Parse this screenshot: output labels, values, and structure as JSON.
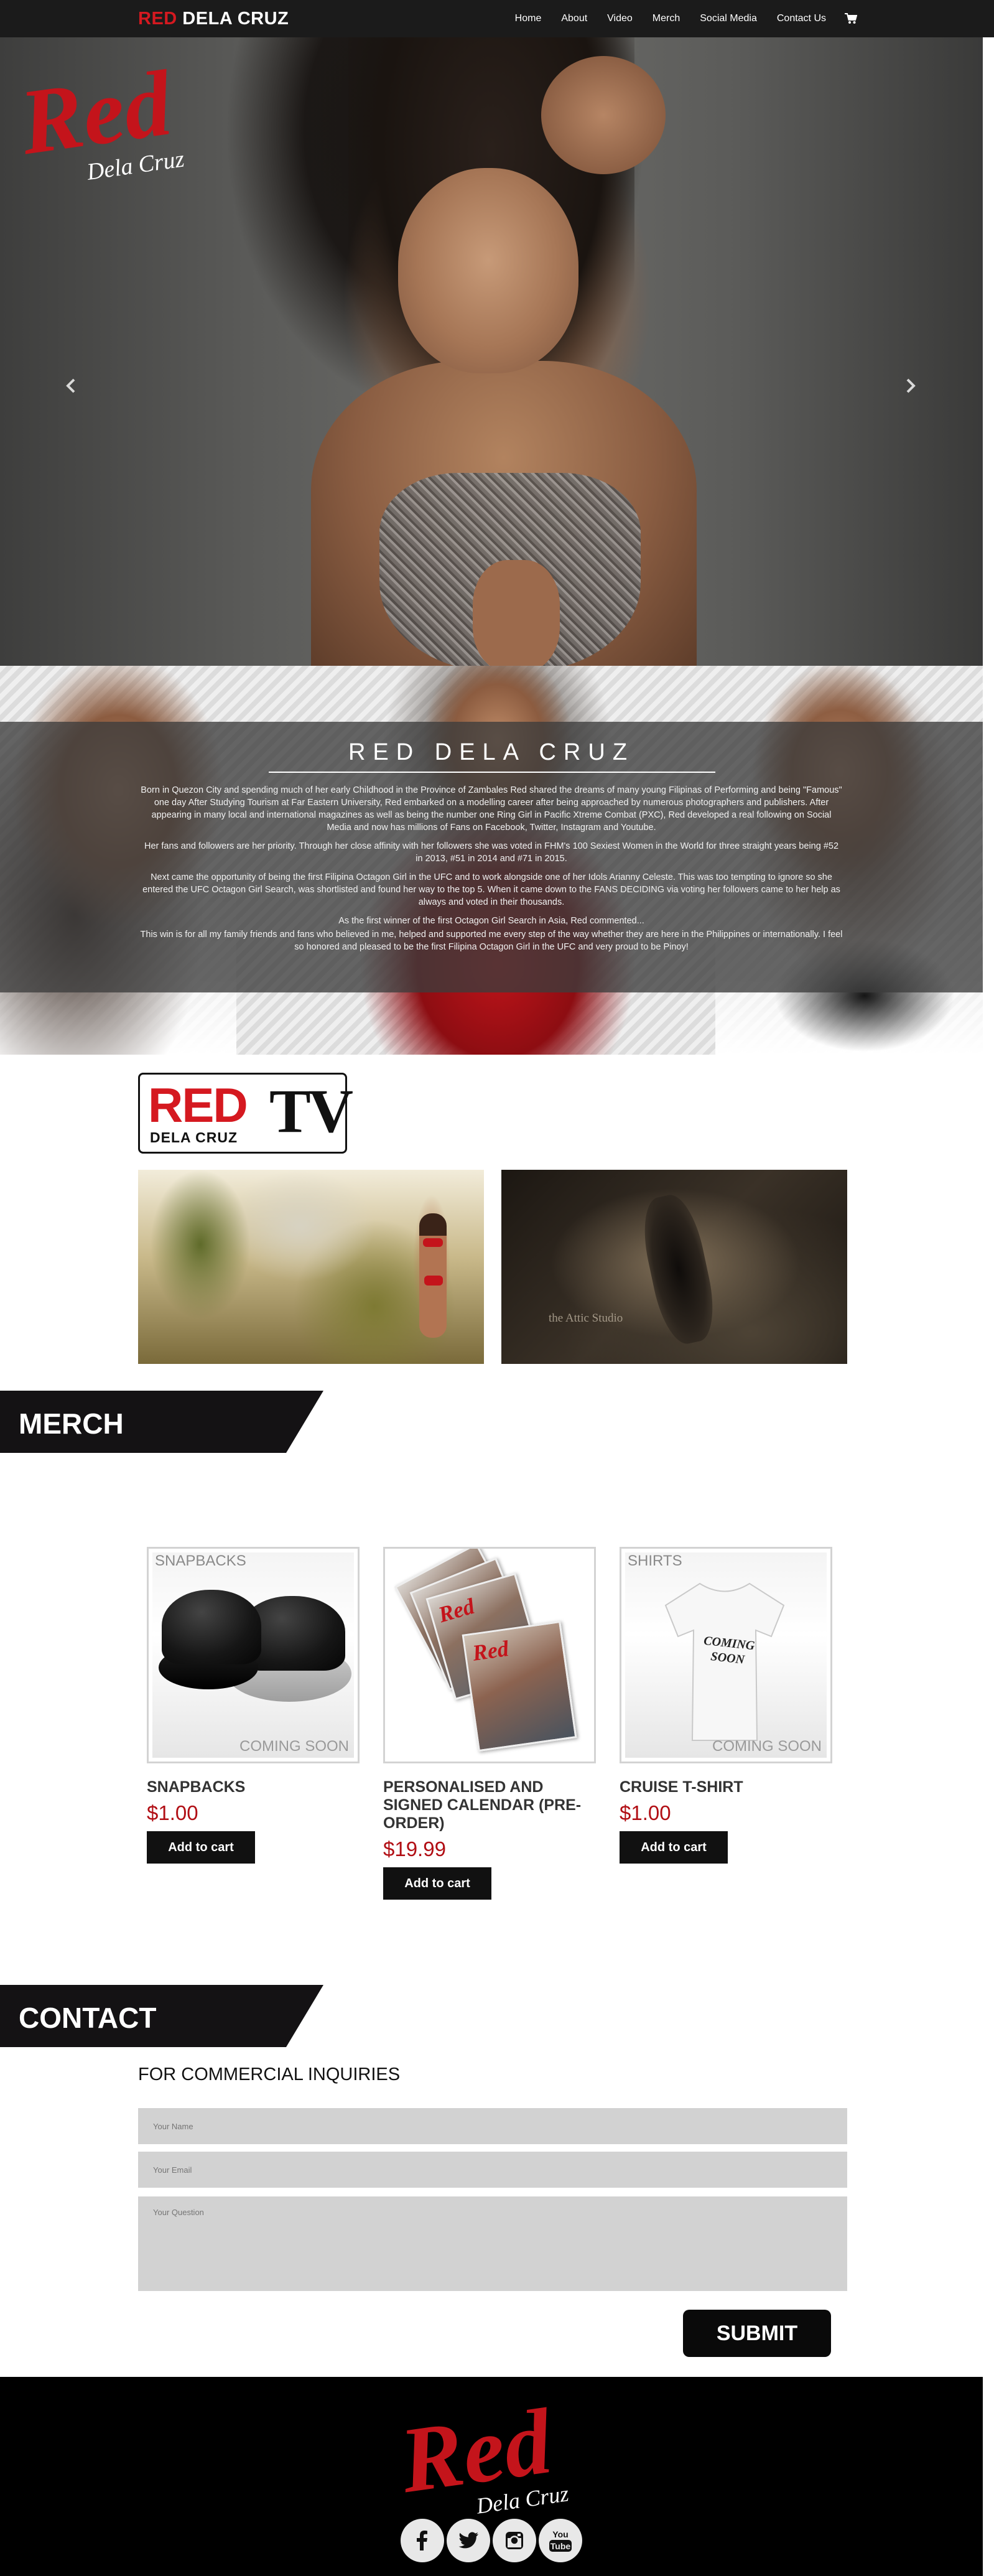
{
  "nav": {
    "brand_red": "RED",
    "brand_rest": "DELA CRUZ",
    "links": [
      "Home",
      "About",
      "Video",
      "Merch",
      "Social Media",
      "Contact Us"
    ],
    "cart_icon": "shopping-cart-icon"
  },
  "hero": {
    "logo_red": "Red",
    "logo_sub": "Dela Cruz",
    "prev_icon": "chevron-left-icon",
    "next_icon": "chevron-right-icon",
    "slide_count": 10,
    "active_slide": 1
  },
  "about": {
    "title": "RED DELA CRUZ",
    "paragraphs": [
      "Born in Quezon City and spending much of her early Childhood in the Province of Zambales Red shared the dreams of many young Filipinas of Performing and being \"Famous\" one day After Studying Tourism at Far Eastern University, Red embarked on a modelling career after being approached by numerous photographers and publishers. After appearing in many local and international magazines as well as being the number one Ring Girl in Pacific Xtreme Combat (PXC), Red developed a real following on Social Media and now has millions of Fans on Facebook, Twitter, Instagram and Youtube.",
      "Her fans and followers are her priority. Through her close affinity with her followers she was voted in  FHM's 100 Sexiest Women in the World for three straight years being #52  in 2013,  #51 in 2014 and #71 in 2015.",
      "Next came the opportunity of being the first Filipina Octagon Girl in the UFC and to work alongside one of her Idols Arianny Celeste. This was too tempting to ignore so she entered the UFC Octagon Girl Search, was shortlisted and found her way to the top 5. When it came down to the FANS DECIDING via voting her followers came to her help as always and voted in their thousands.",
      "As the first winner of the first Octagon Girl Search in Asia, Red commented...",
      "This win is for all my family friends and fans who believed in me, helped and supported me every step of the way whether they are here in the Philippines or internationally. I feel so honored and pleased to be the first Filipina Octagon Girl in the UFC and very proud to be Pinoy!"
    ]
  },
  "redtv": {
    "logo_red": "RED",
    "logo_tv": "TV",
    "logo_sub": "DELA CRUZ",
    "video2_watermark": "the Attic Studio"
  },
  "merch": {
    "heading": "MERCH",
    "products": [
      {
        "corner_label": "SNAPBACKS",
        "soon_label": "COMING SOON",
        "title": "SNAPBACKS",
        "price": "$1.00",
        "button": "Add to cart"
      },
      {
        "corner_label": "",
        "soon_label": "",
        "title": "PERSONALISED AND SIGNED CALENDAR (PRE-ORDER)",
        "price": "$19.99",
        "button": "Add to cart"
      },
      {
        "corner_label": "SHIRTS",
        "soon_label": "COMING SOON",
        "title": "CRUISE T-SHIRT",
        "price": "$1.00",
        "button": "Add to cart",
        "shirt_text": "COMING SOON"
      }
    ]
  },
  "contact": {
    "heading": "CONTACT",
    "subheading": "FOR COMMERCIAL INQUIRIES",
    "name_placeholder": "Your Name",
    "email_placeholder": "Your Email",
    "question_placeholder": "Your Question",
    "submit": "SUBMIT"
  },
  "footer": {
    "logo_red": "Red",
    "logo_sub": "Dela Cruz",
    "social_icons": [
      "facebook-icon",
      "twitter-icon",
      "instagram-icon",
      "youtube-icon"
    ],
    "youtube_text": "You Tube"
  },
  "colors": {
    "brand_red": "#d51920",
    "price_red": "#b10e14",
    "nav_bg": "#1b1b1b"
  }
}
